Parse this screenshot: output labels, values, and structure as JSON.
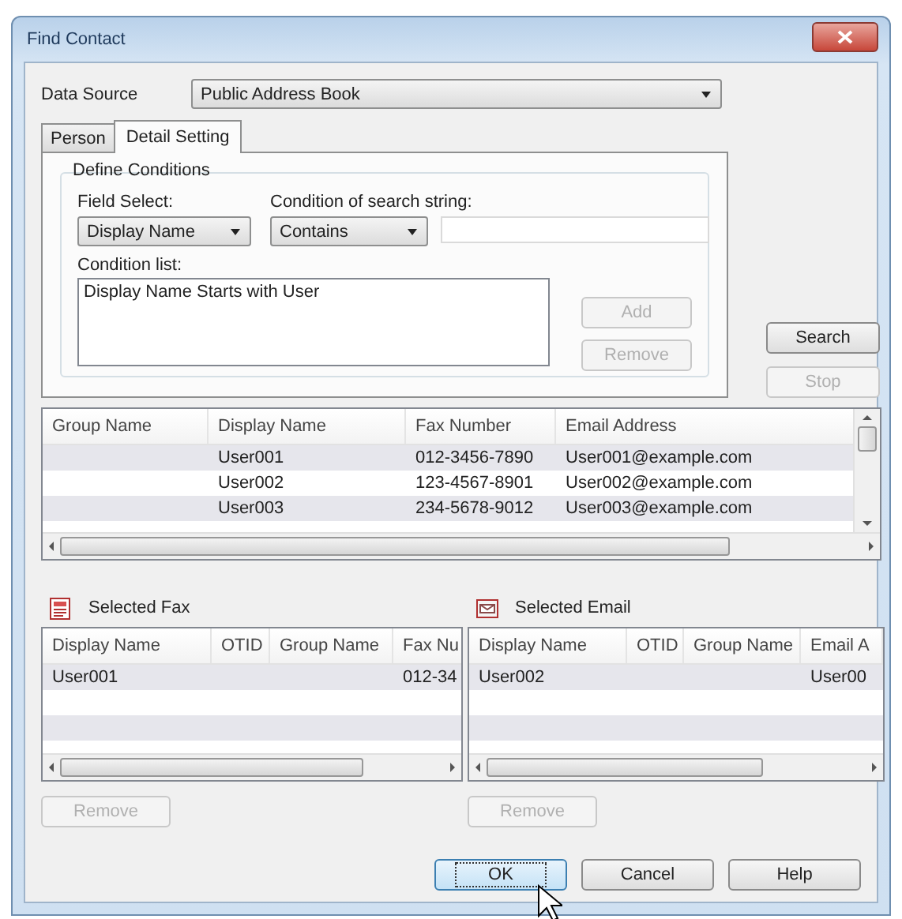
{
  "window": {
    "title": "Find Contact"
  },
  "data_source": {
    "label": "Data Source",
    "value": "Public Address Book"
  },
  "tabs": [
    {
      "label": "Person",
      "selected": false
    },
    {
      "label": "Detail Setting",
      "selected": true
    }
  ],
  "define_conditions": {
    "title": "Define Conditions",
    "field_select": {
      "label": "Field Select:",
      "value": "Display Name"
    },
    "condition": {
      "label": "Condition of search string:",
      "value": "Contains"
    },
    "condition_list": {
      "label": "Condition list:",
      "items": [
        "Display Name Starts with User"
      ]
    },
    "buttons": [
      {
        "label": "Add",
        "disabled": true
      },
      {
        "label": "Remove",
        "disabled": true
      }
    ]
  },
  "side_buttons": [
    {
      "label": "Search",
      "disabled": false
    },
    {
      "label": "Stop",
      "disabled": true
    }
  ],
  "results": {
    "columns": [
      "Group Name",
      "Display Name",
      "Fax Number",
      "Email Address"
    ],
    "rows": [
      {
        "display_name": "User001",
        "fax_number": "012-3456-7890",
        "email_address": "User001@example.com"
      },
      {
        "display_name": "User002",
        "fax_number": "123-4567-8901",
        "email_address": "User002@example.com"
      },
      {
        "display_name": "User003",
        "fax_number": "234-5678-9012",
        "email_address": "User003@example.com"
      }
    ]
  },
  "selected_fax": {
    "title": "Selected Fax",
    "columns": [
      "Display Name",
      "OTID",
      "Group Name",
      "Fax Nu"
    ],
    "rows": [
      {
        "display_name": "User001",
        "column_4": "012-34"
      }
    ],
    "button": {
      "label": "Remove",
      "disabled": true
    }
  },
  "selected_email": {
    "title": "Selected Email",
    "columns": [
      "Display Name",
      "OTID",
      "Group Name",
      "Email A"
    ],
    "rows": [
      {
        "display_name": "User002",
        "column_4": "User00"
      }
    ],
    "button": {
      "label": "Remove",
      "disabled": true
    }
  },
  "dialog_buttons": [
    {
      "label": "OK",
      "focused": true
    },
    {
      "label": "Cancel",
      "focused": false
    },
    {
      "label": "Help",
      "focused": false
    }
  ]
}
